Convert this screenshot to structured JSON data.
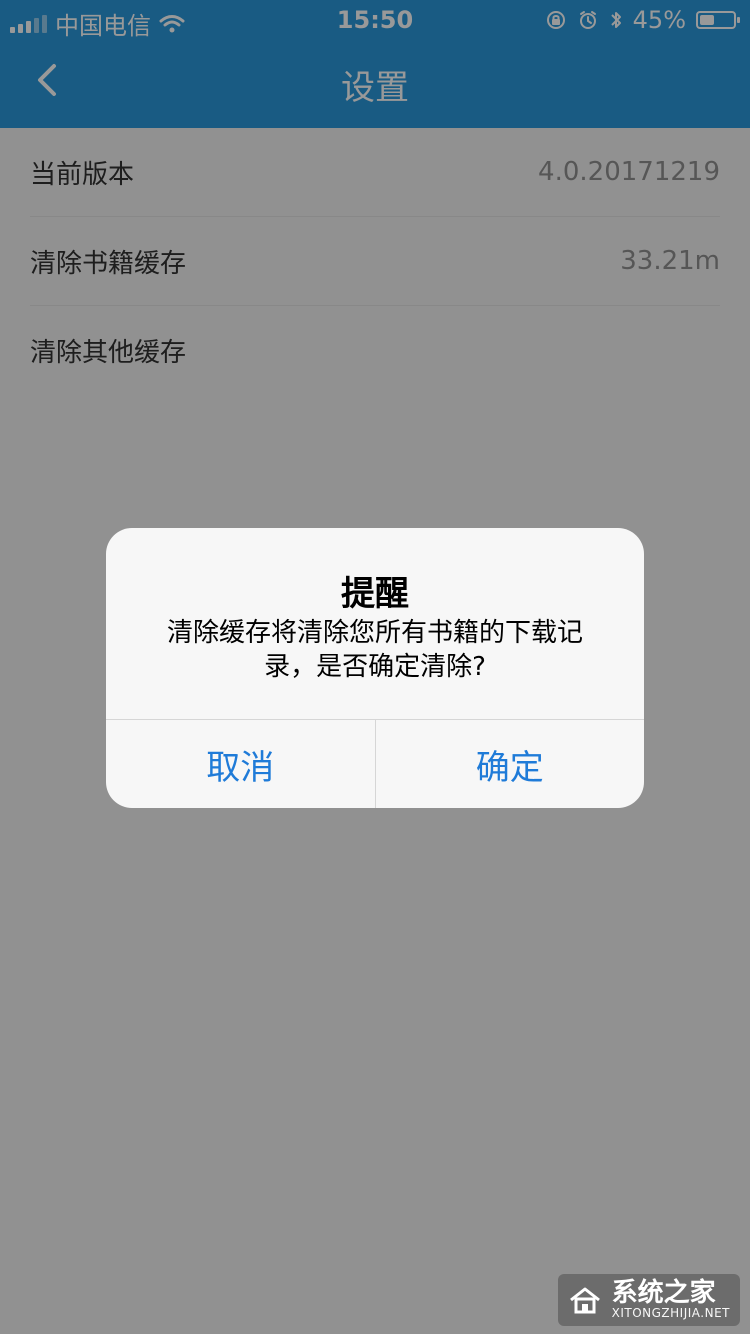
{
  "status_bar": {
    "carrier": "中国电信",
    "time": "15:50",
    "battery_percent": "45%",
    "battery_level": 0.45,
    "icons": [
      "signal-icon",
      "wifi-icon",
      "orientation-lock-icon",
      "alarm-icon",
      "bluetooth-icon",
      "battery-icon"
    ]
  },
  "nav": {
    "back_icon": "chevron-left-icon",
    "title": "设置"
  },
  "settings": [
    {
      "label": "当前版本",
      "value": "4.0.20171219"
    },
    {
      "label": "清除书籍缓存",
      "value": "33.21m"
    },
    {
      "label": "清除其他缓存",
      "value": ""
    }
  ],
  "dialog": {
    "title": "提醒",
    "message": "清除缓存将清除您所有书籍的下载记录，是否确定清除?",
    "cancel": "取消",
    "confirm": "确定"
  },
  "watermark": {
    "brand": "系统之家",
    "domain": "XITONGZHIJIA.NET"
  },
  "colors": {
    "accent": "#2a98da",
    "dialog_button": "#1f7bd8",
    "text_primary": "#333333",
    "text_secondary": "#8f8f8f"
  }
}
